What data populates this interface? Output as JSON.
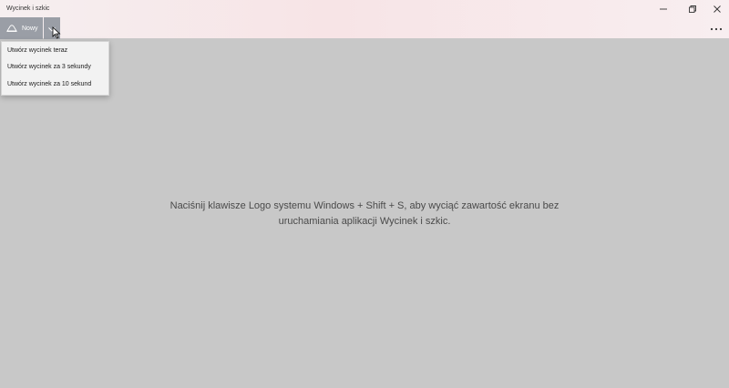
{
  "window": {
    "title": "Wycinek i szkic"
  },
  "titlebar": {
    "minimize_icon": "minimize-icon",
    "restore_icon": "restore-icon",
    "close_icon": "close-icon"
  },
  "toolbar": {
    "new_label": "Nowy",
    "new_icon": "snip-icon",
    "dropdown_icon": "chevron-down-icon",
    "more_icon": "more-icon"
  },
  "dropdown": {
    "items": [
      {
        "label": "Utwórz wycinek teraz"
      },
      {
        "label": "Utwórz wycinek za 3 sekundy"
      },
      {
        "label": "Utwórz wycinek za 10 sekund"
      }
    ]
  },
  "main": {
    "hint_line1": "Naciśnij klawisze Logo systemu Windows + Shift + S, aby wyciąć zawartość ekranu bez",
    "hint_line2": "uruchamiania aplikacji Wycinek i szkic."
  },
  "colors": {
    "background": "#c8c8c8",
    "button": "#9a9ea6",
    "titlebar_accent": "#f7e4e6"
  }
}
